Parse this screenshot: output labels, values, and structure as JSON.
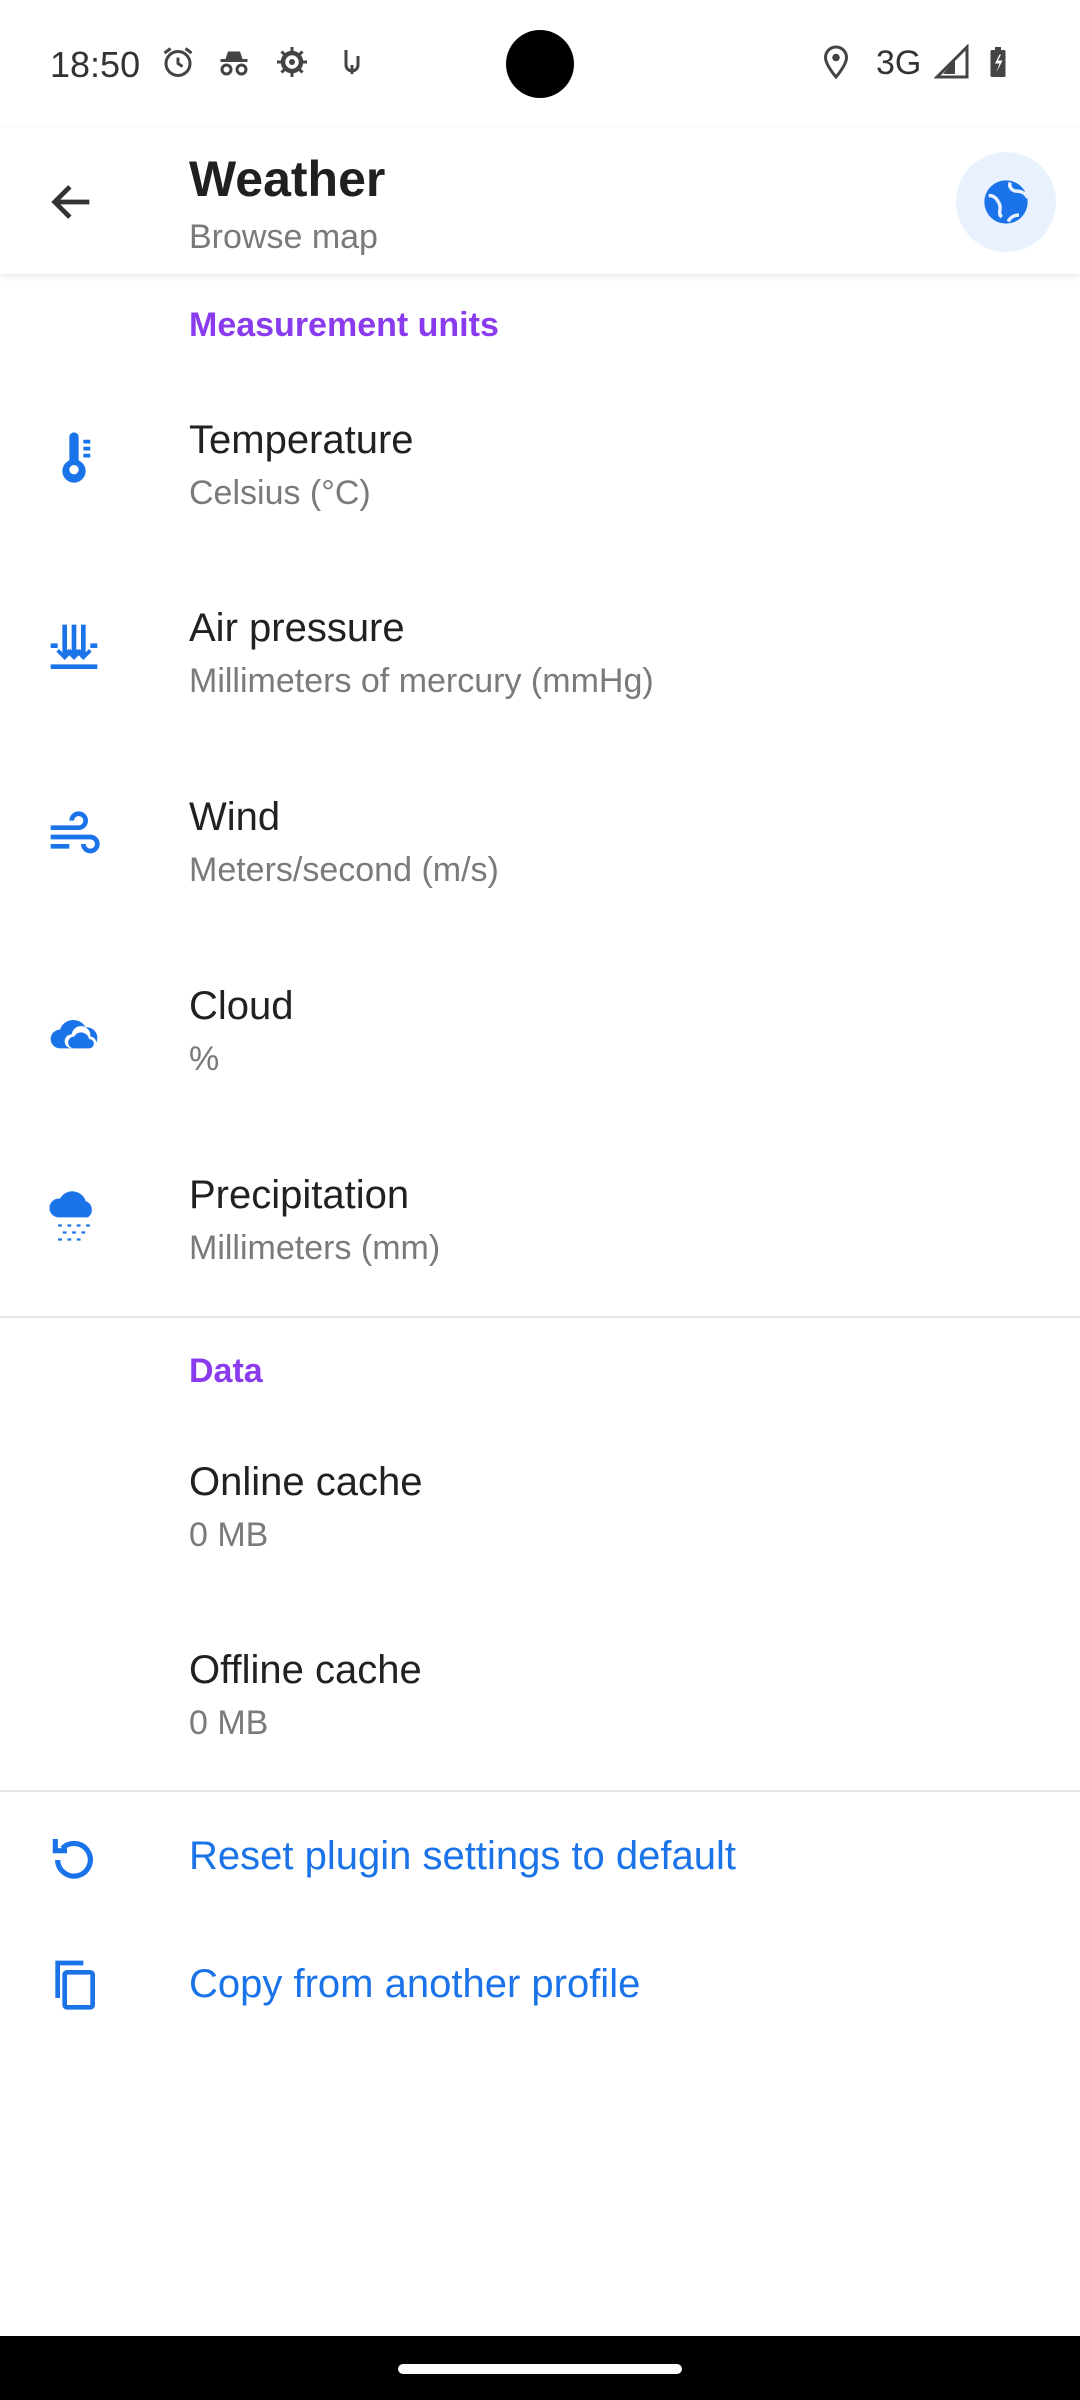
{
  "status_bar": {
    "time": "18:50",
    "network": "3G",
    "icons": [
      "alarm-icon",
      "incognito-icon",
      "settings-icon",
      "usb-icon",
      "location-icon",
      "signal-icon",
      "battery-icon"
    ]
  },
  "app_bar": {
    "title": "Weather",
    "subtitle": "Browse map",
    "back_icon": "arrow-back-icon",
    "action_icon": "globe-icon"
  },
  "measurement_units": {
    "header": "Measurement units",
    "items": [
      {
        "label": "Temperature",
        "value": "Celsius (°C)",
        "icon": "thermometer-icon"
      },
      {
        "label": "Air pressure",
        "value": "Millimeters of mercury (mmHg)",
        "icon": "air-pressure-icon"
      },
      {
        "label": "Wind",
        "value": "Meters/second (m/s)",
        "icon": "wind-icon"
      },
      {
        "label": "Cloud",
        "value": "%",
        "icon": "cloud-icon"
      },
      {
        "label": "Precipitation",
        "value": "Millimeters (mm)",
        "icon": "precipitation-icon"
      }
    ]
  },
  "data_section": {
    "header": "Data",
    "items": [
      {
        "label": "Online cache",
        "value": "0 MB"
      },
      {
        "label": "Offline cache",
        "value": "0 MB"
      }
    ]
  },
  "actions": [
    {
      "label": "Reset plugin settings to default",
      "icon": "reset-icon"
    },
    {
      "label": "Copy from another profile",
      "icon": "copy-icon"
    }
  ],
  "colors": {
    "accent_purple": "#8a3bed",
    "accent_blue": "#1a73e8"
  }
}
